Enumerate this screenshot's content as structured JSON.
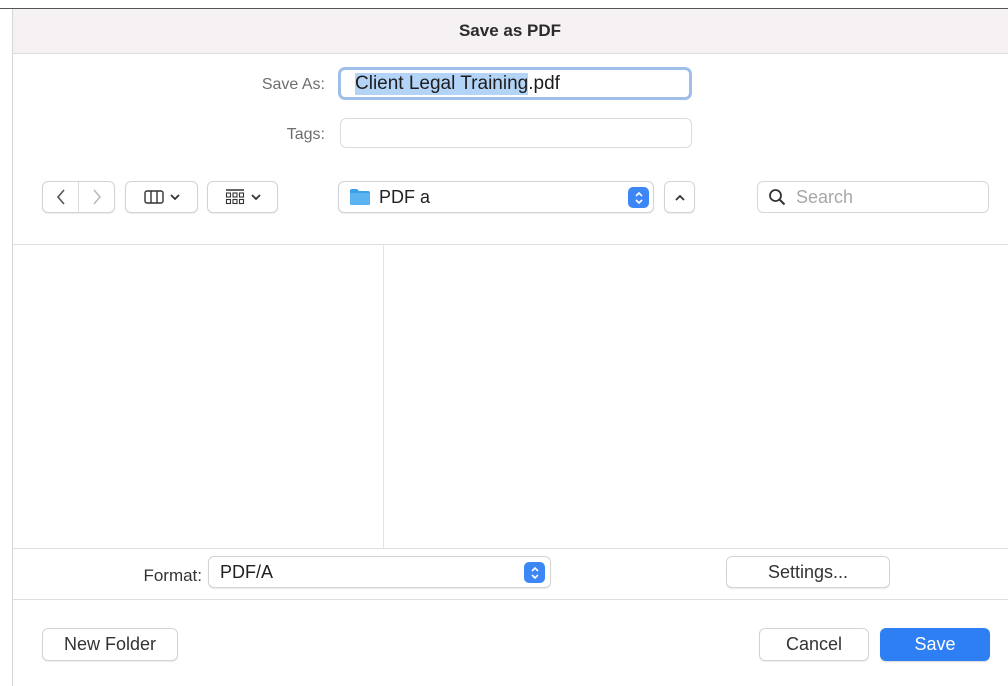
{
  "dialog": {
    "title": "Save as PDF"
  },
  "save_as": {
    "label": "Save As:",
    "filename_selected": "Client Legal Training",
    "filename_extension": ".pdf"
  },
  "tags": {
    "label": "Tags:",
    "value": ""
  },
  "toolbar": {
    "back_icon": "chevron-left-icon",
    "forward_icon": "chevron-right-icon",
    "view_icon": "column-view-icon",
    "group_icon": "group-grid-icon",
    "location": "PDF a",
    "location_icon": "folder-icon",
    "up_icon": "chevron-up-icon",
    "search_placeholder": "Search"
  },
  "format": {
    "label": "Format:",
    "value": "PDF/A"
  },
  "buttons": {
    "settings": "Settings...",
    "new_folder": "New Folder",
    "cancel": "Cancel",
    "save": "Save"
  },
  "colors": {
    "accent": "#2f7ff4",
    "selection": "#b3d3f7",
    "folder": "#3aa0e8"
  }
}
